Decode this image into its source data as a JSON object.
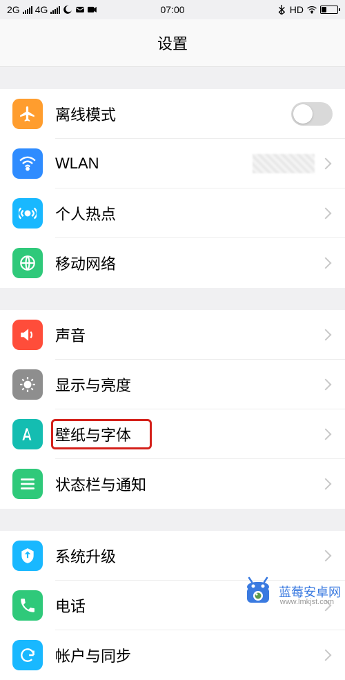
{
  "status": {
    "left1": "2G",
    "left2": "4G",
    "time": "07:00",
    "right1": "HD"
  },
  "header": {
    "title": "设置"
  },
  "sections": [
    {
      "rows": [
        {
          "name": "airplane",
          "label": "离线模式",
          "icon_color": "#ff9d2e",
          "control": "toggle"
        },
        {
          "name": "wlan",
          "label": "WLAN",
          "icon_color": "#2f8cff",
          "control": "chevron",
          "blur": true
        },
        {
          "name": "hotspot",
          "label": "个人热点",
          "icon_color": "#19b8ff",
          "control": "chevron"
        },
        {
          "name": "mobile-data",
          "label": "移动网络",
          "icon_color": "#2fc97a",
          "control": "chevron"
        }
      ]
    },
    {
      "rows": [
        {
          "name": "sound",
          "label": "声音",
          "icon_color": "#ff4d3a",
          "control": "chevron"
        },
        {
          "name": "display",
          "label": "显示与亮度",
          "icon_color": "#8e8e8e",
          "control": "chevron"
        },
        {
          "name": "wallpaper",
          "label": "壁纸与字体",
          "icon_color": "#14bdb1",
          "control": "chevron",
          "highlight": true
        },
        {
          "name": "notification",
          "label": "状态栏与通知",
          "icon_color": "#2fc97a",
          "control": "chevron"
        }
      ]
    },
    {
      "rows": [
        {
          "name": "update",
          "label": "系统升级",
          "icon_color": "#19b8ff",
          "control": "chevron"
        },
        {
          "name": "phone",
          "label": "电话",
          "icon_color": "#2fc97a",
          "control": "chevron"
        },
        {
          "name": "account",
          "label": "帐户与同步",
          "icon_color": "#19b8ff",
          "control": "chevron"
        }
      ]
    }
  ],
  "watermark": {
    "text": "蓝莓安卓网",
    "url": "www.lmkjst.com"
  }
}
